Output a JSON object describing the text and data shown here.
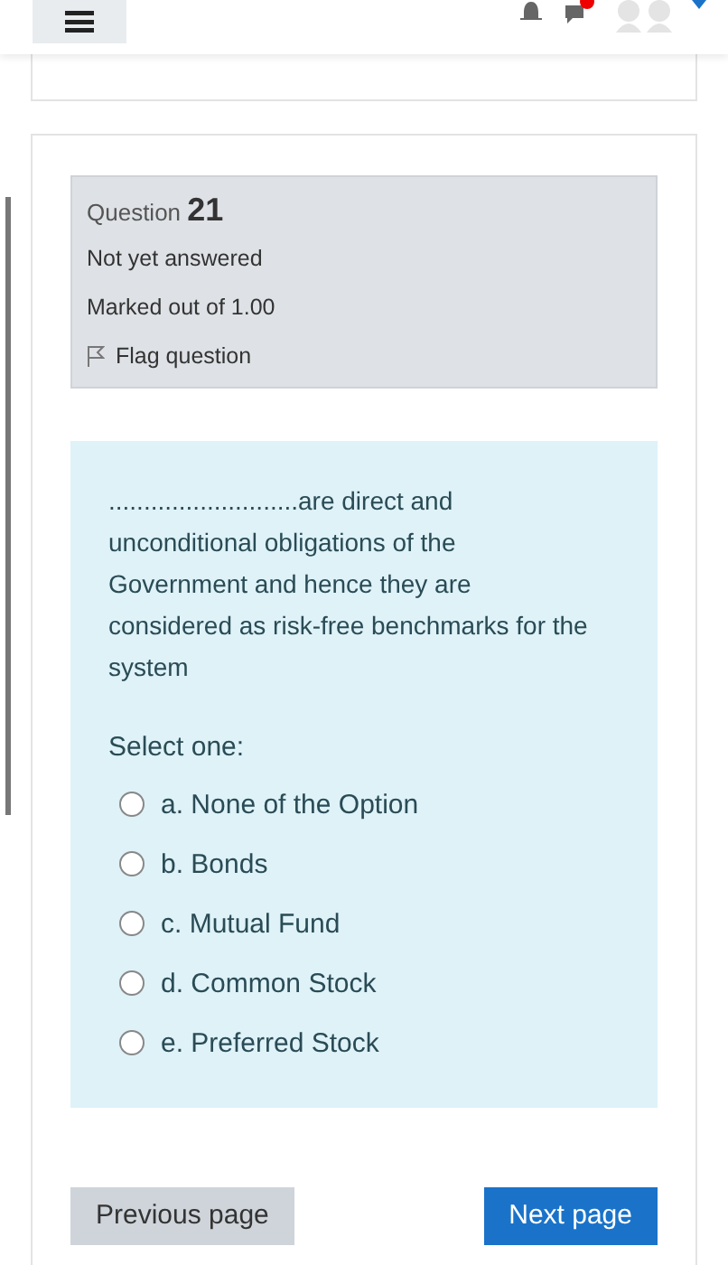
{
  "header": {
    "notification_dot": true
  },
  "question": {
    "label": "Question",
    "number": "21",
    "status": "Not yet answered",
    "marks": "Marked out of 1.00",
    "flag": "Flag question",
    "flagged": false,
    "text": "...........................are direct and unconditional obligations of the Government and hence they are considered as risk-free benchmarks for the system",
    "prompt": "Select one:",
    "options": [
      {
        "label": "a. None of the Option",
        "selected": false
      },
      {
        "label": "b. Bonds",
        "selected": false
      },
      {
        "label": "c. Mutual Fund",
        "selected": false
      },
      {
        "label": "d. Common Stock",
        "selected": false
      },
      {
        "label": "e. Preferred Stock",
        "selected": false
      }
    ]
  },
  "buttons": [
    {
      "label": "Previous page",
      "kind": "secondary"
    },
    {
      "label": "Next page",
      "kind": "primary"
    }
  ]
}
